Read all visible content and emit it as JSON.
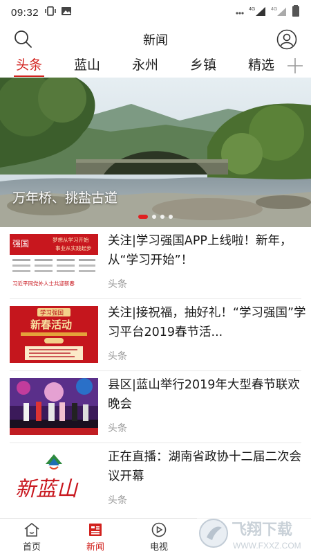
{
  "status_bar": {
    "time": "09:32",
    "signal_1": "4G",
    "signal_2": "4G"
  },
  "header": {
    "title": "新闻"
  },
  "tabs": [
    {
      "label": "头条",
      "active": true
    },
    {
      "label": "蓝山",
      "active": false
    },
    {
      "label": "永州",
      "active": false
    },
    {
      "label": "乡镇",
      "active": false
    },
    {
      "label": "精选",
      "active": false
    }
  ],
  "banner": {
    "caption": "万年桥、挑盐古道",
    "slide_count": 4,
    "active_slide": 1
  },
  "news": [
    {
      "title": "关注|学习强国APP上线啦！新年，从“学习开始”！",
      "tag": "头条",
      "thumb": {
        "logo": "强国",
        "headline": "梦想从学习开始",
        "subline": "事业从实践起步",
        "footer": "习近平同党外人士共迎新春"
      }
    },
    {
      "title": "关注|接祝福，抽好礼！“学习强国”学习平台2019春节活...",
      "tag": "头条",
      "thumb": {
        "top": "学习强国",
        "main": "新春活动"
      }
    },
    {
      "title": "县区|蓝山举行2019年大型春节联欢晚会",
      "tag": "头条",
      "thumb": {}
    },
    {
      "title": "正在直播：湖南省政协十二届二次会议开幕",
      "tag": "头条",
      "thumb": {
        "calligraphy": "新蓝山"
      }
    }
  ],
  "bottom_nav": [
    {
      "label": "首页",
      "icon": "home-icon",
      "active": false
    },
    {
      "label": "新闻",
      "icon": "news-icon",
      "active": true
    },
    {
      "label": "电视",
      "icon": "tv-icon",
      "active": false
    }
  ],
  "watermark": {
    "text": "飞翔下载",
    "url_text": "WWW.FXXZ.COM"
  },
  "colors": {
    "accent": "#d2221e",
    "tag_gray": "#999999"
  }
}
